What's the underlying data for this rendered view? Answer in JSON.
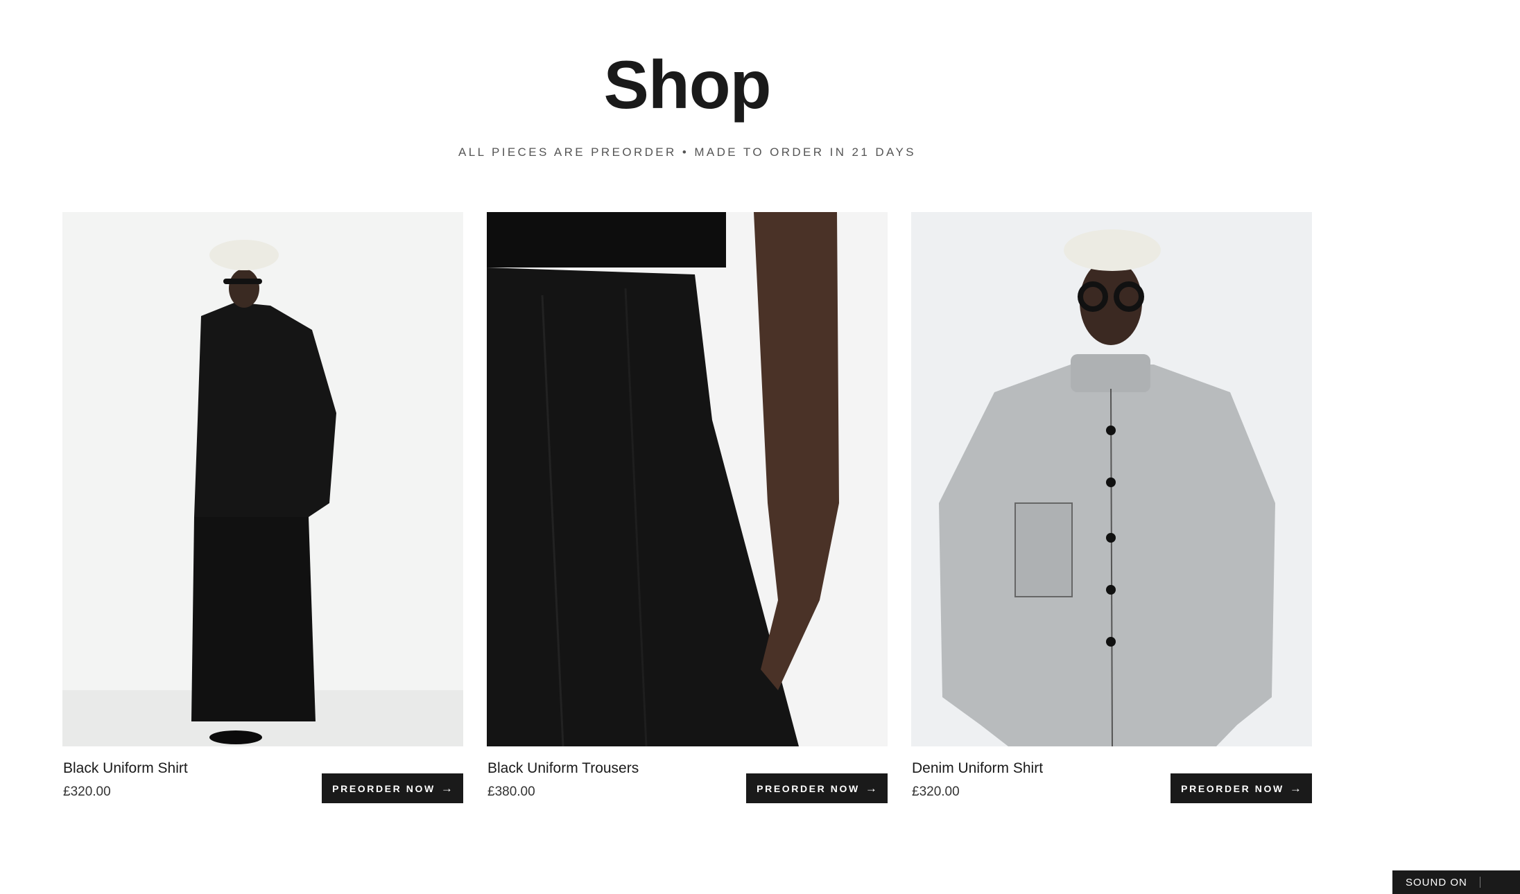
{
  "page": {
    "title": "Shop",
    "subtitle": "ALL PIECES ARE PREORDER • MADE TO ORDER IN 21 DAYS"
  },
  "products": [
    {
      "name": "Black Uniform Shirt",
      "price": "£320.00",
      "button": "PREORDER NOW",
      "arrow": "→"
    },
    {
      "name": "Black Uniform Trousers",
      "price": "£380.00",
      "button": "PREORDER NOW",
      "arrow": "→"
    },
    {
      "name": "Denim Uniform Shirt",
      "price": "£320.00",
      "button": "PREORDER NOW",
      "arrow": "→"
    }
  ],
  "sound_toggle": {
    "label": "SOUND ON"
  },
  "colors": {
    "text": "#1a1a1a",
    "button_bg": "#1a1a1a",
    "button_text": "#ffffff",
    "page_bg": "#ffffff"
  }
}
